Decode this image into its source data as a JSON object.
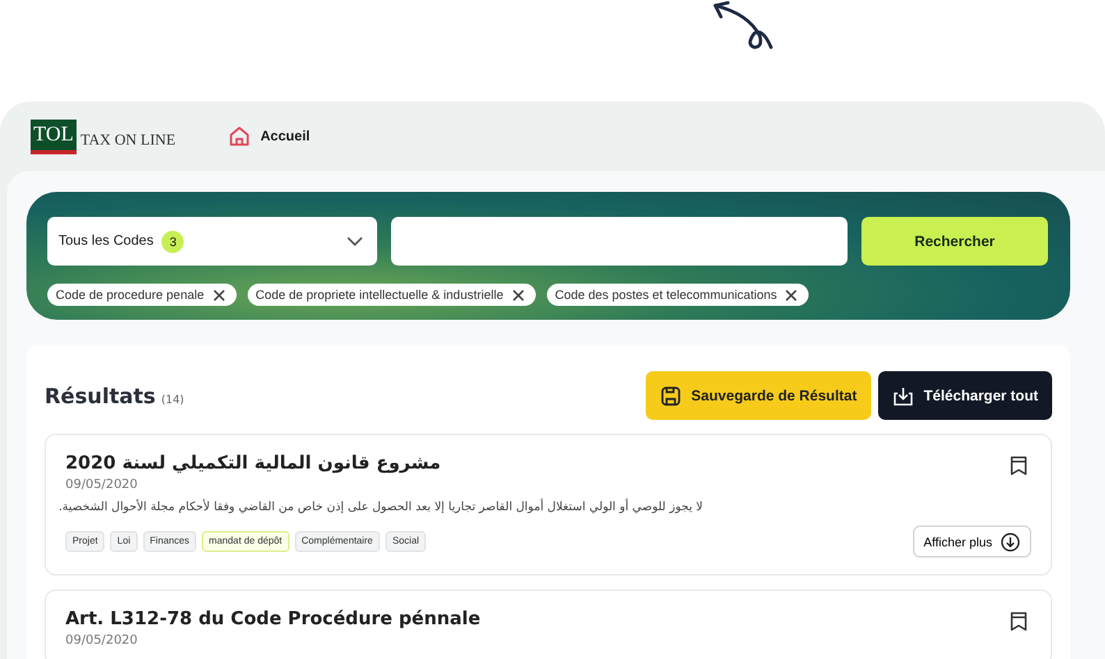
{
  "logo": {
    "mark": "TOL",
    "name": "TAX ON LINE"
  },
  "nav": [
    {
      "label": "Accueil"
    }
  ],
  "search": {
    "select": {
      "label": "Tous les Codes",
      "count": "3"
    },
    "button": "Rechercher",
    "chips": [
      {
        "label": "Code de procedure penale"
      },
      {
        "label": "Code de propriete intellectuelle & industrielle"
      },
      {
        "label": "Code des postes et telecommunications"
      }
    ]
  },
  "results": {
    "title": "Résultats",
    "count": "(14)",
    "save_button": "Sauvegarde de Résultat",
    "download_button": "Télécharger tout",
    "items": [
      {
        "title": "مشروع قانون المالية التكميلي لسنة 2020",
        "date": "09/05/2020",
        "excerpt": "لا يجوز للوصي أو الولي استغلال أموال القاصر تجاريا إلا بعد الحصول على إذن خاص من القاضي وفقا لأحكام مجلة الأحوال الشخصية.",
        "tags": [
          {
            "label": "Projet",
            "highlighted": false
          },
          {
            "label": "Loi",
            "highlighted": false
          },
          {
            "label": "Finances",
            "highlighted": false
          },
          {
            "label": "mandat de dépôt",
            "highlighted": true
          },
          {
            "label": "Complémentaire",
            "highlighted": false
          },
          {
            "label": "Social",
            "highlighted": false
          }
        ],
        "more_button": "Afficher plus"
      },
      {
        "title": "Art. L312-78  du Code Procédure pénnale",
        "date": "09/05/2020"
      }
    ]
  }
}
